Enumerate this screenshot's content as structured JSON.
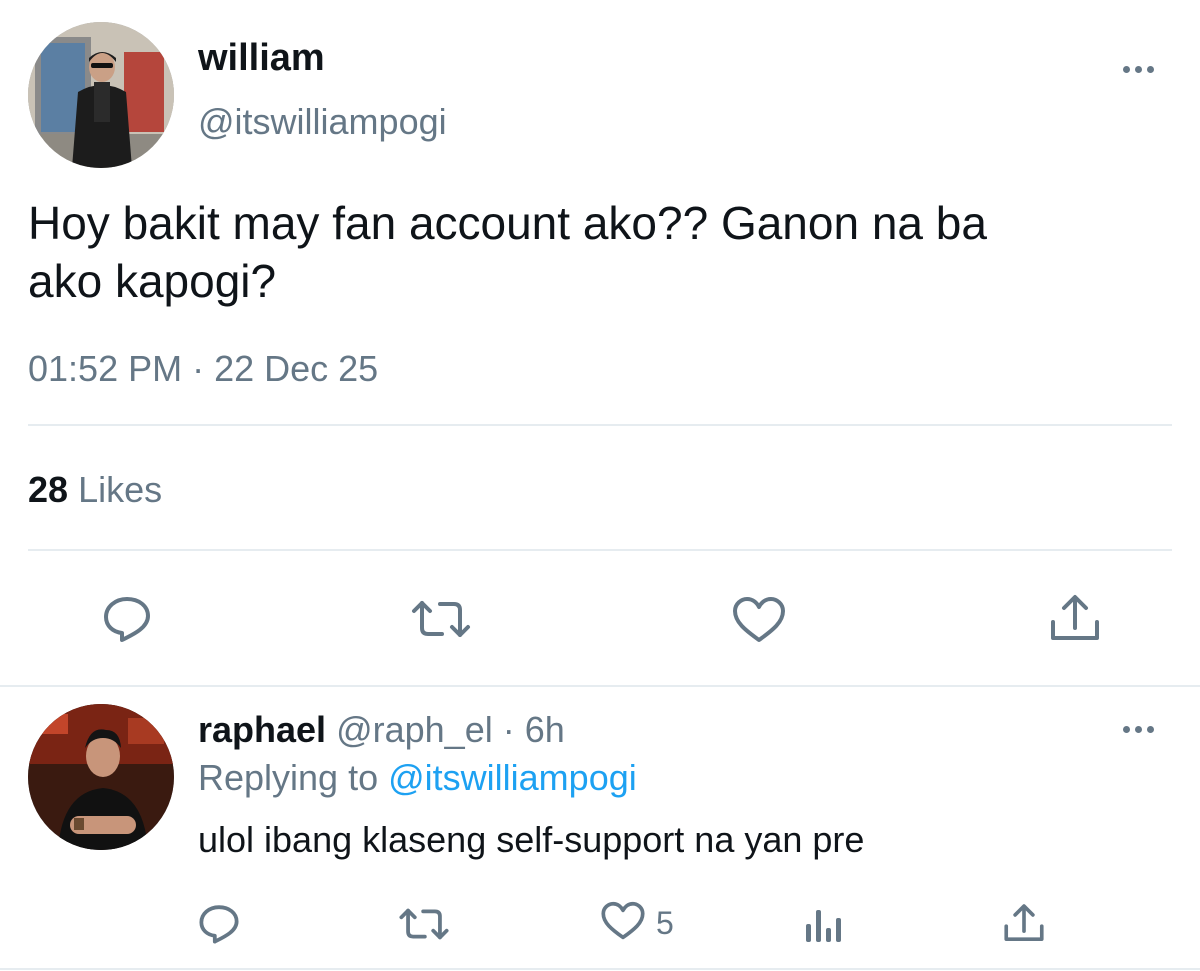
{
  "tweet": {
    "display_name": "william",
    "handle": "@itswilliampogi",
    "text_line1": "Hoy bakit may fan account ako?? Ganon na ba",
    "text_line2": "ako kapogi?",
    "timestamp": "01:52 PM · 22 Dec 25",
    "likes_count": "28",
    "likes_label": "Likes",
    "actions": [
      "reply-icon",
      "retweet-icon",
      "like-icon",
      "share-icon"
    ]
  },
  "reply": {
    "display_name": "raphael",
    "handle": "@raph_el",
    "age": "· 6h",
    "replying_prefix": "Replying to",
    "replying_handle": "@itswilliampogi",
    "text": "ulol ibang klaseng self-support na yan pre",
    "likes_count": "5",
    "actions": [
      "reply-icon",
      "retweet-icon",
      "like-icon",
      "analytics-icon",
      "share-icon"
    ]
  },
  "colors": {
    "text": "#0f1419",
    "muted": "#657786",
    "link": "#1da1f2",
    "divider": "#e6ecf0"
  }
}
